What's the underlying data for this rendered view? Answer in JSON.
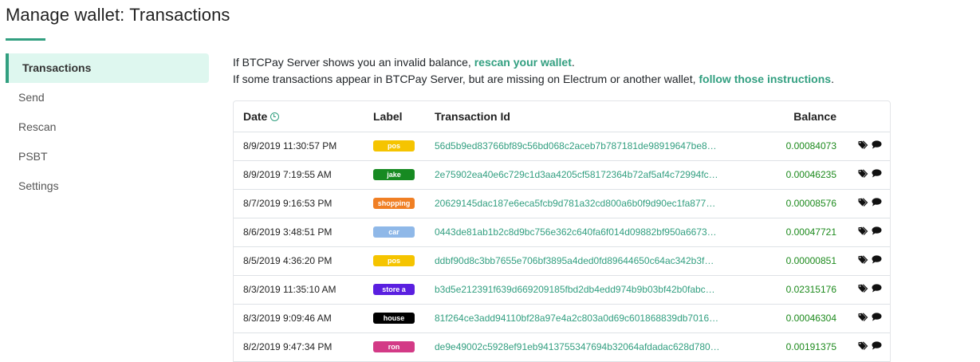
{
  "page": {
    "title": "Manage wallet: Transactions"
  },
  "sidebar": {
    "items": [
      {
        "label": "Transactions",
        "active": true
      },
      {
        "label": "Send"
      },
      {
        "label": "Rescan"
      },
      {
        "label": "PSBT"
      },
      {
        "label": "Settings"
      }
    ]
  },
  "info": {
    "line1_prefix": "If BTCPay Server shows you an invalid balance, ",
    "line1_link": "rescan your wallet",
    "line1_suffix": ".",
    "line2_prefix": "If some transactions appear in BTCPay Server, but are missing on Electrum or another wallet, ",
    "line2_link": "follow those instructions",
    "line2_suffix": "."
  },
  "table": {
    "headers": {
      "date": "Date",
      "label": "Label",
      "tx": "Transaction Id",
      "balance": "Balance"
    },
    "rows": [
      {
        "date": "8/9/2019 11:30:57 PM",
        "label": "pos",
        "label_color": "#f5c400",
        "tx": "56d5b9ed83766bf89c56bd068c2aceb7b787181de98919647be8…",
        "balance": "0.00084073"
      },
      {
        "date": "8/9/2019 7:19:55 AM",
        "label": "jake",
        "label_color": "#178a22",
        "tx": "2e75902ea40e6c729c1d3aa4205cf58172364b72af5af4c72994fc…",
        "balance": "0.00046235"
      },
      {
        "date": "8/7/2019 9:16:53 PM",
        "label": "shopping",
        "label_color": "#f07f24",
        "tx": "20629145dac187e6eca5fcb9d781a32cd800a6b0f9d90ec1fa877…",
        "balance": "0.00008576"
      },
      {
        "date": "8/6/2019 3:48:51 PM",
        "label": "car",
        "label_color": "#8fb8e8",
        "tx": "0443de81ab1b2c8d9bc756e362c640fa6f014d09882bf950a6673…",
        "balance": "0.00047721"
      },
      {
        "date": "8/5/2019 4:36:20 PM",
        "label": "pos",
        "label_color": "#f5c400",
        "tx": "ddbf90d8c3bb7655e706bf3895a4ded0fd89644650c64ac342b3f…",
        "balance": "0.00000851"
      },
      {
        "date": "8/3/2019 11:35:10 AM",
        "label": "store a",
        "label_color": "#5a1fe0",
        "tx": "b3d5e212391f639d669209185fbd2db4edd974b9b03bf42b0fabc…",
        "balance": "0.02315176"
      },
      {
        "date": "8/3/2019 9:09:46 AM",
        "label": "house",
        "label_color": "#000000",
        "tx": "81f264ce3add94110bf28a97e4a2c803a0d69c601868839db7016…",
        "balance": "0.00046304"
      },
      {
        "date": "8/2/2019 9:47:34 PM",
        "label": "ron",
        "label_color": "#d33a86",
        "tx": "de9e49002c5928ef91eb9413755347694b32064afdadac628d780…",
        "balance": "0.00191375"
      }
    ]
  },
  "colors": {
    "accent": "#329f80",
    "balance": "#1d8a1d",
    "active_bg": "#def7ef"
  },
  "icons": {
    "date_header": "clock-icon",
    "row_actions": [
      "tag-icon",
      "comment-icon"
    ]
  }
}
